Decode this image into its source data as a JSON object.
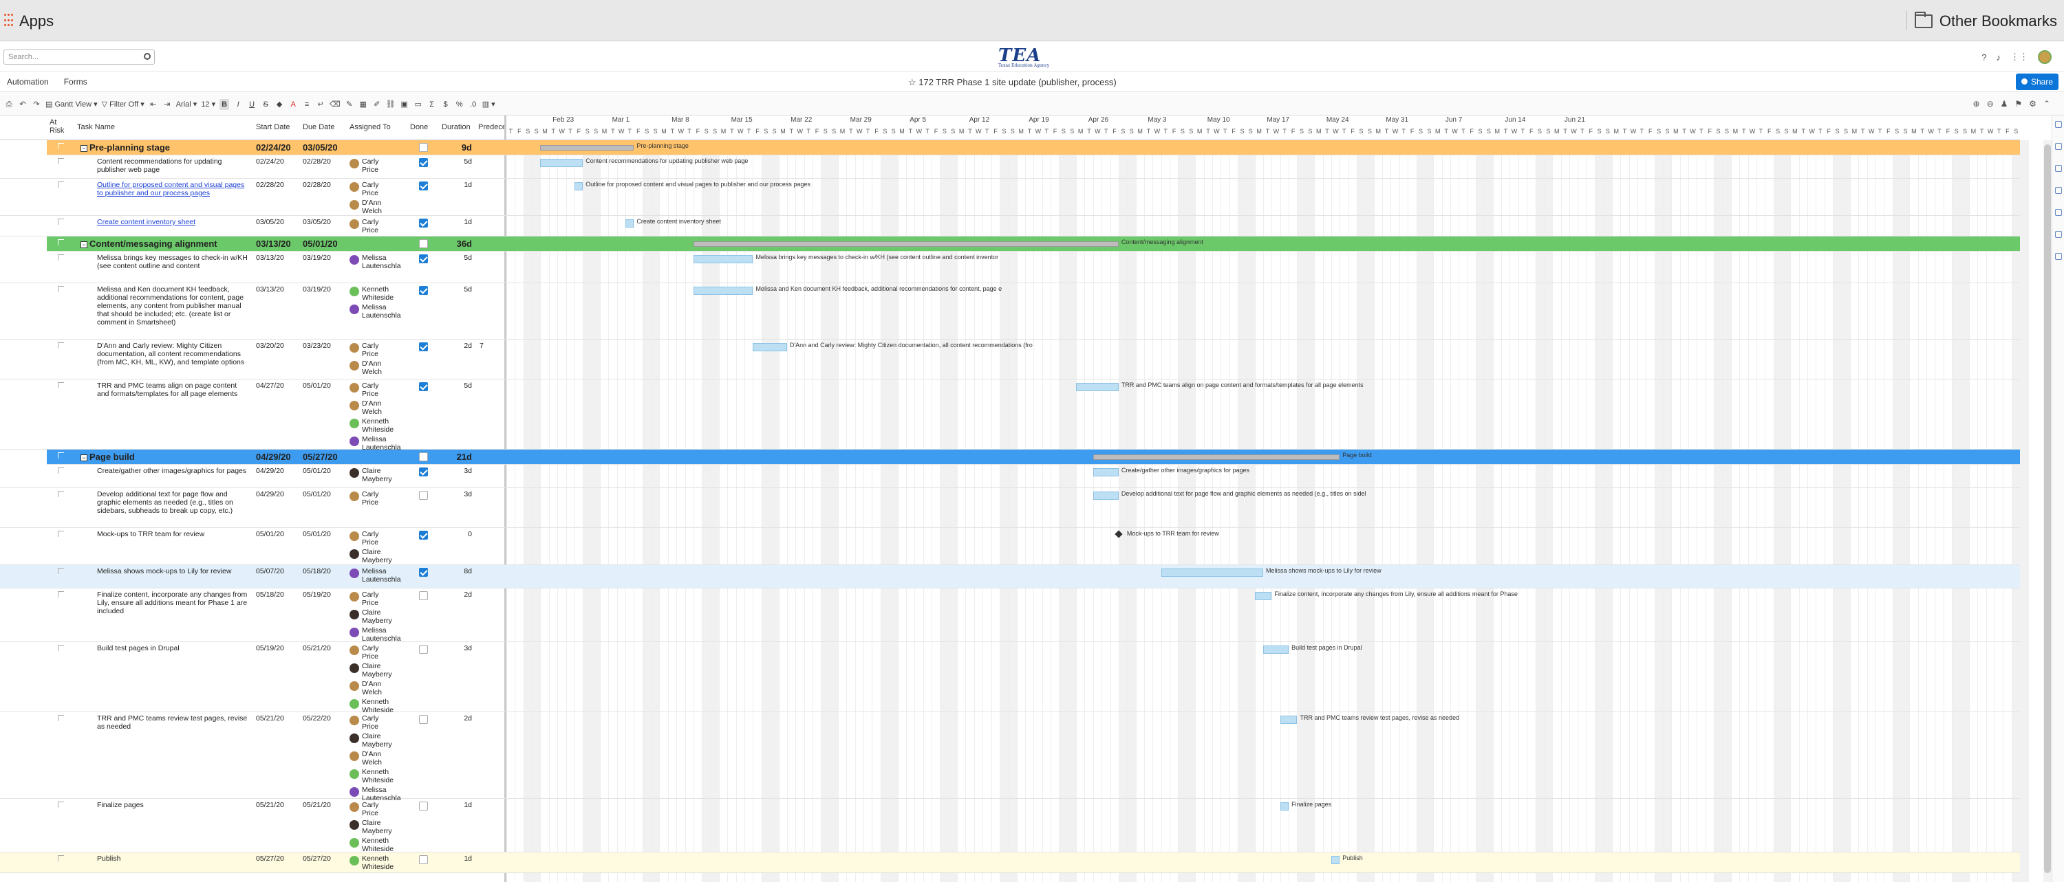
{
  "bookmarks": {
    "apps_label": "Apps",
    "other_label": "Other Bookmarks"
  },
  "appbar": {
    "search_placeholder": "Search...",
    "logo": "TEA",
    "logo_sub": "Texas Education Agency"
  },
  "subbar": {
    "tabs": [
      "Automation",
      "Forms"
    ],
    "sheet_title": "172 TRR Phase 1 site update (publisher, process)",
    "share_label": "Share"
  },
  "toolbar": {
    "view_label": "Gantt View",
    "filter_label": "Filter Off",
    "font": "Arial",
    "font_size": "12",
    "bold": "B",
    "italic": "I",
    "underline": "U",
    "strike": "S",
    "text_color": "A",
    "sum": "Σ",
    "currency": "$",
    "percent": "%"
  },
  "columns": {
    "at_risk": "At Risk",
    "task_name": "Task Name",
    "start_date": "Start Date",
    "due_date": "Due Date",
    "assigned": "Assigned To",
    "done": "Done",
    "duration": "Duration",
    "predecessors": "Predece"
  },
  "gantt": {
    "months": [
      "Feb 23",
      "Mar 1",
      "Mar 8",
      "Mar 15",
      "Mar 22",
      "Mar 29",
      "Apr 5",
      "Apr 12",
      "Apr 19",
      "Apr 26",
      "May 3",
      "May 10",
      "May 17",
      "May 24",
      "May 31",
      "Jun 7",
      "Jun 14",
      "Jun 21"
    ],
    "day_letters": [
      "S",
      "M",
      "T",
      "W",
      "T",
      "F",
      "S"
    ],
    "start_date": "2020-02-20"
  },
  "rows": [
    {
      "type": "phase",
      "color": "#ffc36b",
      "name": "Pre-planning stage",
      "start": "02/24/20",
      "due": "03/05/20",
      "assigned": [],
      "done": false,
      "duration": "9d",
      "pred": "",
      "bar_label": "Pre-planning stage"
    },
    {
      "type": "task",
      "name": "Content recommendations for updating publisher web page",
      "start": "02/24/20",
      "due": "02/28/20",
      "assigned": [
        [
          "Carly",
          "Price"
        ]
      ],
      "done": true,
      "duration": "5d",
      "pred": "",
      "bar_label": "Content recommendations for updating publisher web page"
    },
    {
      "type": "task",
      "link": true,
      "name": "Outline for proposed content and visual pages to publisher and our process pages",
      "start": "02/28/20",
      "due": "02/28/20",
      "assigned": [
        [
          "Carly",
          "Price"
        ],
        [
          "D'Ann",
          "Welch"
        ]
      ],
      "done": true,
      "duration": "1d",
      "pred": "",
      "bar_label": "Outline for proposed content and visual pages to publisher and our process pages"
    },
    {
      "type": "task",
      "link": true,
      "name": "Create content inventory sheet",
      "start": "03/05/20",
      "due": "03/05/20",
      "assigned": [
        [
          "Carly",
          "Price"
        ]
      ],
      "done": true,
      "duration": "1d",
      "pred": "",
      "bar_label": "Create content inventory sheet"
    },
    {
      "type": "phase",
      "color": "#6cc96a",
      "name": "Content/messaging alignment",
      "start": "03/13/20",
      "due": "05/01/20",
      "assigned": [],
      "done": false,
      "duration": "36d",
      "pred": "",
      "bar_label": "Content/messaging alignment"
    },
    {
      "type": "task",
      "name": "Melissa brings key messages to check-in w/KH (see content outline and content",
      "start": "03/13/20",
      "due": "03/19/20",
      "assigned": [
        [
          "Melissa",
          "Lautenschla"
        ]
      ],
      "done": true,
      "duration": "5d",
      "pred": "",
      "bar_label": "Melissa brings key messages to check-in w/KH (see content outline and content inventor"
    },
    {
      "type": "task",
      "name": "Melissa and Ken document KH feedback, additional recommendations for content, page elements, any content from publisher manual that should be included; etc. (create list or comment in Smartsheet)",
      "start": "03/13/20",
      "due": "03/19/20",
      "assigned": [
        [
          "Kenneth",
          "Whiteside"
        ],
        [
          "Melissa",
          "Lautenschla"
        ]
      ],
      "done": true,
      "duration": "5d",
      "pred": "",
      "bar_label": "Melissa and Ken document KH feedback, additional recommendations for content, page e"
    },
    {
      "type": "task",
      "name": "D'Ann and Carly review: Mighty Citizen documentation, all content recommendations (from MC, KH, ML, KW), and template options",
      "start": "03/20/20",
      "due": "03/23/20",
      "assigned": [
        [
          "Carly",
          "Price"
        ],
        [
          "D'Ann",
          "Welch"
        ]
      ],
      "done": true,
      "duration": "2d",
      "pred": "7",
      "bar_label": "D'Ann and Carly review: Mighty Citizen documentation, all content recommendations (fro"
    },
    {
      "type": "task",
      "name": "TRR and PMC teams align on page content and formats/templates for all page elements",
      "start": "04/27/20",
      "due": "05/01/20",
      "assigned": [
        [
          "Carly",
          "Price"
        ],
        [
          "D'Ann",
          "Welch"
        ],
        [
          "Kenneth",
          "Whiteside"
        ],
        [
          "Melissa",
          "Lautenschla"
        ]
      ],
      "done": true,
      "duration": "5d",
      "pred": "",
      "bar_label": "TRR and PMC teams align on page content and formats/templates for all page elements"
    },
    {
      "type": "phase",
      "color": "#3d9cf0",
      "name": "Page build",
      "start": "04/29/20",
      "due": "05/27/20",
      "assigned": [],
      "done": false,
      "duration": "21d",
      "pred": "",
      "bar_label": "Page build"
    },
    {
      "type": "task",
      "name": "Create/gather other images/graphics for pages",
      "start": "04/29/20",
      "due": "05/01/20",
      "assigned": [
        [
          "Claire",
          "Mayberry"
        ]
      ],
      "done": true,
      "duration": "3d",
      "pred": "",
      "bar_label": "Create/gather other images/graphics for pages"
    },
    {
      "type": "task",
      "name": "Develop additional text for page flow and graphic elements as needed (e.g., titles on sidebars, subheads to break up copy, etc.)",
      "start": "04/29/20",
      "due": "05/01/20",
      "assigned": [
        [
          "Carly",
          "Price"
        ]
      ],
      "done": false,
      "duration": "3d",
      "pred": "",
      "bar_label": "Develop additional text for page flow and graphic elements as needed (e.g., titles on sidel"
    },
    {
      "type": "task",
      "name": "Mock-ups to TRR team for review",
      "start": "05/01/20",
      "due": "05/01/20",
      "assigned": [
        [
          "Carly",
          "Price"
        ],
        [
          "Claire",
          "Mayberry"
        ]
      ],
      "done": true,
      "duration": "0",
      "pred": "",
      "bar_label": "Mock-ups to TRR team for review",
      "milestone": true
    },
    {
      "type": "task",
      "highlight": true,
      "name": "Melissa shows mock-ups to Lily for review",
      "start": "05/07/20",
      "due": "05/18/20",
      "assigned": [
        [
          "Melissa",
          "Lautenschla"
        ]
      ],
      "done": true,
      "duration": "8d",
      "pred": "",
      "bar_label": "Melissa shows mock-ups to Lily for review"
    },
    {
      "type": "task",
      "name": "Finalize content, incorporate any changes from Lily, ensure all additions meant for Phase 1 are included",
      "start": "05/18/20",
      "due": "05/19/20",
      "assigned": [
        [
          "Carly",
          "Price"
        ],
        [
          "Claire",
          "Mayberry"
        ],
        [
          "Melissa",
          "Lautenschla"
        ]
      ],
      "done": false,
      "duration": "2d",
      "pred": "",
      "bar_label": "Finalize content, incorporate any changes from Lily, ensure all additions meant for Phase"
    },
    {
      "type": "task",
      "name": "Build test pages in Drupal",
      "start": "05/19/20",
      "due": "05/21/20",
      "assigned": [
        [
          "Carly",
          "Price"
        ],
        [
          "Claire",
          "Mayberry"
        ],
        [
          "D'Ann",
          "Welch"
        ],
        [
          "Kenneth",
          "Whiteside"
        ]
      ],
      "done": false,
      "duration": "3d",
      "pred": "",
      "bar_label": "Build test pages in Drupal"
    },
    {
      "type": "task",
      "name": "TRR and PMC teams review test pages, revise as needed",
      "start": "05/21/20",
      "due": "05/22/20",
      "assigned": [
        [
          "Carly",
          "Price"
        ],
        [
          "Claire",
          "Mayberry"
        ],
        [
          "D'Ann",
          "Welch"
        ],
        [
          "Kenneth",
          "Whiteside"
        ],
        [
          "Melissa",
          "Lautenschla"
        ]
      ],
      "done": false,
      "duration": "2d",
      "pred": "",
      "bar_label": "TRR and PMC teams review test pages, revise as needed"
    },
    {
      "type": "task",
      "name": "Finalize pages",
      "start": "05/21/20",
      "due": "05/21/20",
      "assigned": [
        [
          "Carly",
          "Price"
        ],
        [
          "Claire",
          "Mayberry"
        ],
        [
          "Kenneth",
          "Whiteside"
        ]
      ],
      "done": false,
      "duration": "1d",
      "pred": "",
      "bar_label": "Finalize pages"
    },
    {
      "type": "task",
      "yellow": true,
      "name": "Publish",
      "start": "05/27/20",
      "due": "05/27/20",
      "assigned": [
        [
          "Kenneth",
          "Whiteside"
        ]
      ],
      "done": false,
      "duration": "1d",
      "pred": "",
      "bar_label": "Publish"
    }
  ],
  "colors": {
    "accent": "#0b75d9",
    "preplan": "#ffc36b",
    "content": "#6cc96a",
    "build": "#3d9cf0",
    "bar": "#bcdff4"
  }
}
